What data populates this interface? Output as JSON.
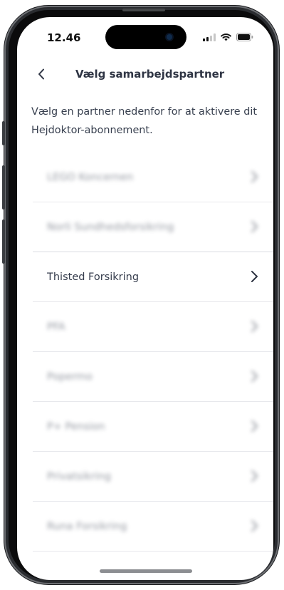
{
  "status_bar": {
    "time": "12.46"
  },
  "header": {
    "title": "Vælg samarbejdspartner"
  },
  "intro": {
    "text": "Vælg en partner nedenfor for at aktivere dit Hejdoktor-abonnement."
  },
  "partners": [
    {
      "label": "LEGO Koncernen",
      "blurred": true
    },
    {
      "label": "Norli Sundhedsforsikring",
      "blurred": true
    },
    {
      "label": "Thisted Forsikring",
      "blurred": false
    },
    {
      "label": "PFA",
      "blurred": true
    },
    {
      "label": "Popermo",
      "blurred": true
    },
    {
      "label": "P+ Pension",
      "blurred": true
    },
    {
      "label": "Privatsikring",
      "blurred": true
    },
    {
      "label": "Runa Forsikring",
      "blurred": true
    }
  ],
  "icons": {
    "back": "chevron-left-icon",
    "row_chevron": "chevron-right-icon",
    "signal": "cellular-signal-icon",
    "wifi": "wifi-icon",
    "battery": "battery-icon"
  },
  "colors": {
    "text": "#2f3544",
    "divider": "#e7e8ec",
    "frame": "#2a2c30"
  }
}
